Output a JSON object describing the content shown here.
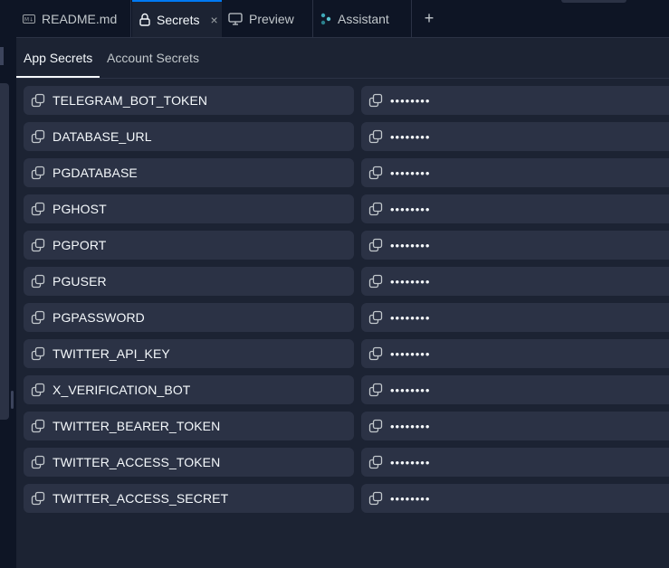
{
  "tabs": [
    {
      "label": "README.md",
      "icon": "markdown-icon",
      "active": false
    },
    {
      "label": "Secrets",
      "icon": "lock-icon",
      "active": true,
      "close": "×"
    },
    {
      "label": "Preview",
      "icon": "monitor-icon",
      "active": false
    },
    {
      "label": "Assistant",
      "icon": "assistant-icon",
      "active": false
    }
  ],
  "add_tab_label": "+",
  "subtabs": [
    {
      "label": "App Secrets",
      "active": true
    },
    {
      "label": "Account Secrets",
      "active": false
    }
  ],
  "secrets": [
    {
      "key": "TELEGRAM_BOT_TOKEN",
      "value": "••••••••"
    },
    {
      "key": "DATABASE_URL",
      "value": "••••••••"
    },
    {
      "key": "PGDATABASE",
      "value": "••••••••"
    },
    {
      "key": "PGHOST",
      "value": "••••••••"
    },
    {
      "key": "PGPORT",
      "value": "••••••••"
    },
    {
      "key": "PGUSER",
      "value": "••••••••"
    },
    {
      "key": "PGPASSWORD",
      "value": "••••••••"
    },
    {
      "key": "TWITTER_API_KEY",
      "value": "••••••••"
    },
    {
      "key": "X_VERIFICATION_BOT",
      "value": "••••••••"
    },
    {
      "key": "TWITTER_BEARER_TOKEN",
      "value": "••••••••"
    },
    {
      "key": "TWITTER_ACCESS_TOKEN",
      "value": "••••••••"
    },
    {
      "key": "TWITTER_ACCESS_SECRET",
      "value": "••••••••"
    }
  ],
  "colors": {
    "background": "#1c2333",
    "surface": "#2b3245",
    "accent": "#0079f2",
    "chrome": "#0e1525"
  }
}
